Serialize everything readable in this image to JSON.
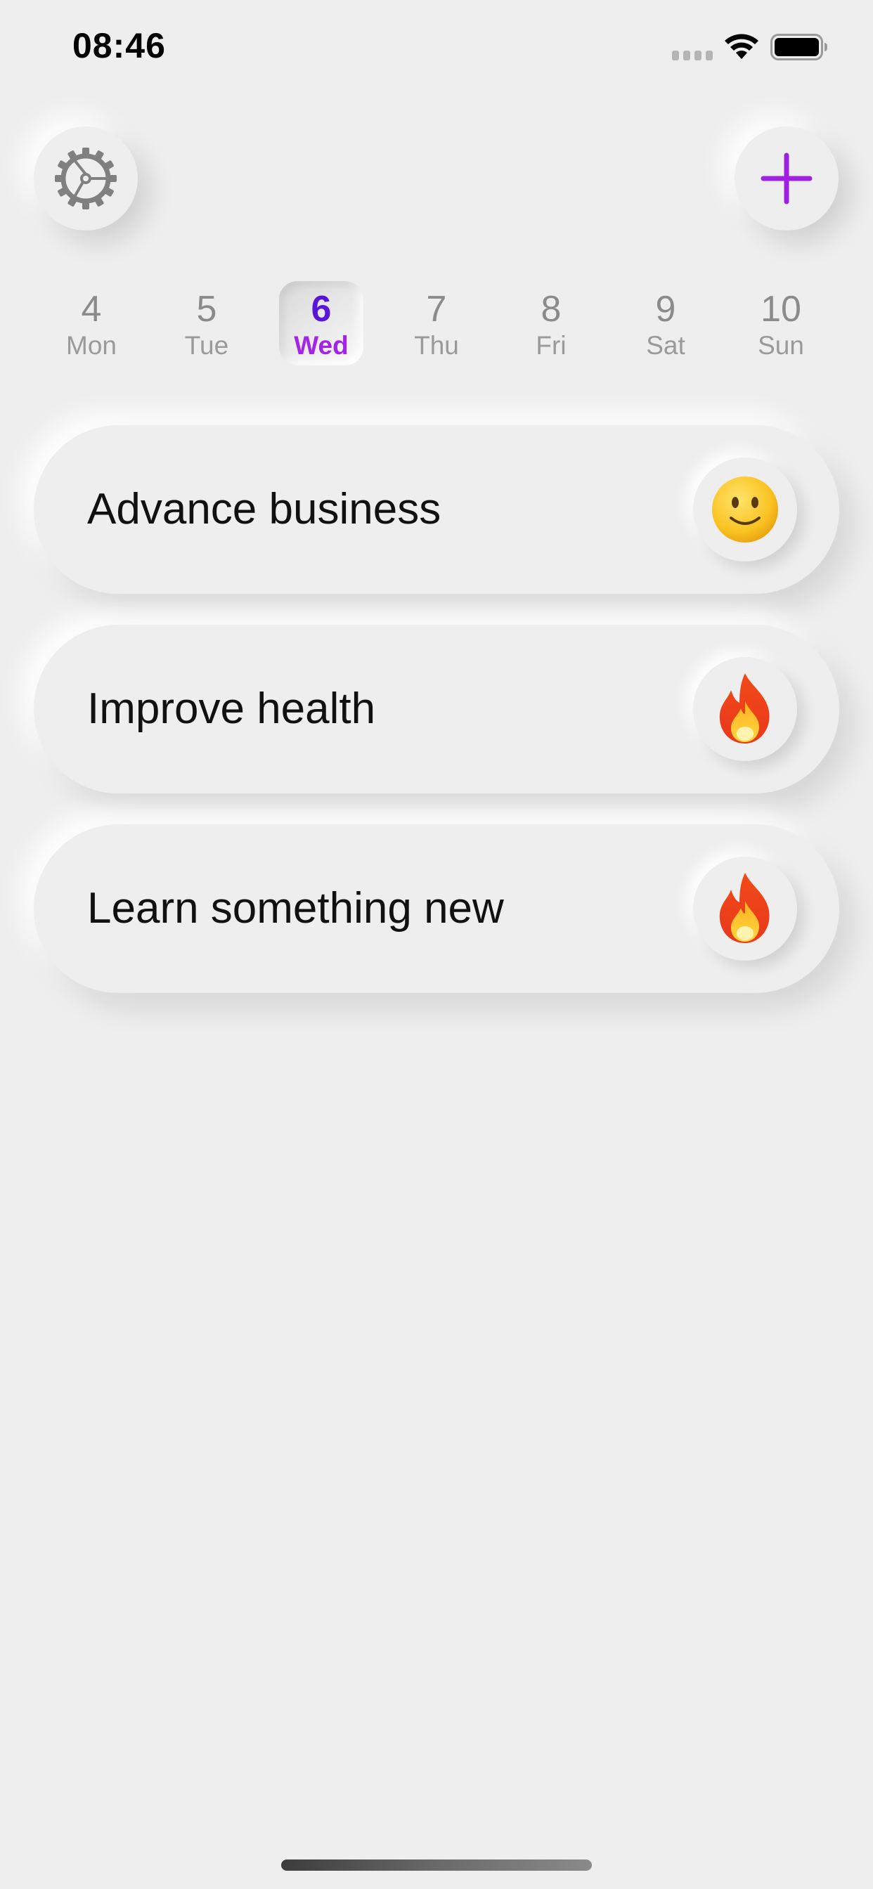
{
  "status_bar": {
    "time": "08:46"
  },
  "toolbar": {
    "settings_icon": "gear-icon",
    "add_icon": "plus-icon",
    "accent_color": "#a020e0"
  },
  "week": {
    "days": [
      {
        "num": "4",
        "name": "Mon",
        "selected": false
      },
      {
        "num": "5",
        "name": "Tue",
        "selected": false
      },
      {
        "num": "6",
        "name": "Wed",
        "selected": true
      },
      {
        "num": "7",
        "name": "Thu",
        "selected": false
      },
      {
        "num": "8",
        "name": "Fri",
        "selected": false
      },
      {
        "num": "9",
        "name": "Sat",
        "selected": false
      },
      {
        "num": "10",
        "name": "Sun",
        "selected": false
      }
    ],
    "selected_color": "#5a16d8"
  },
  "goals": [
    {
      "label": "Advance business",
      "icon": "slightly-smiling-face-icon"
    },
    {
      "label": "Improve health",
      "icon": "fire-icon"
    },
    {
      "label": "Learn something new",
      "icon": "fire-icon"
    }
  ]
}
